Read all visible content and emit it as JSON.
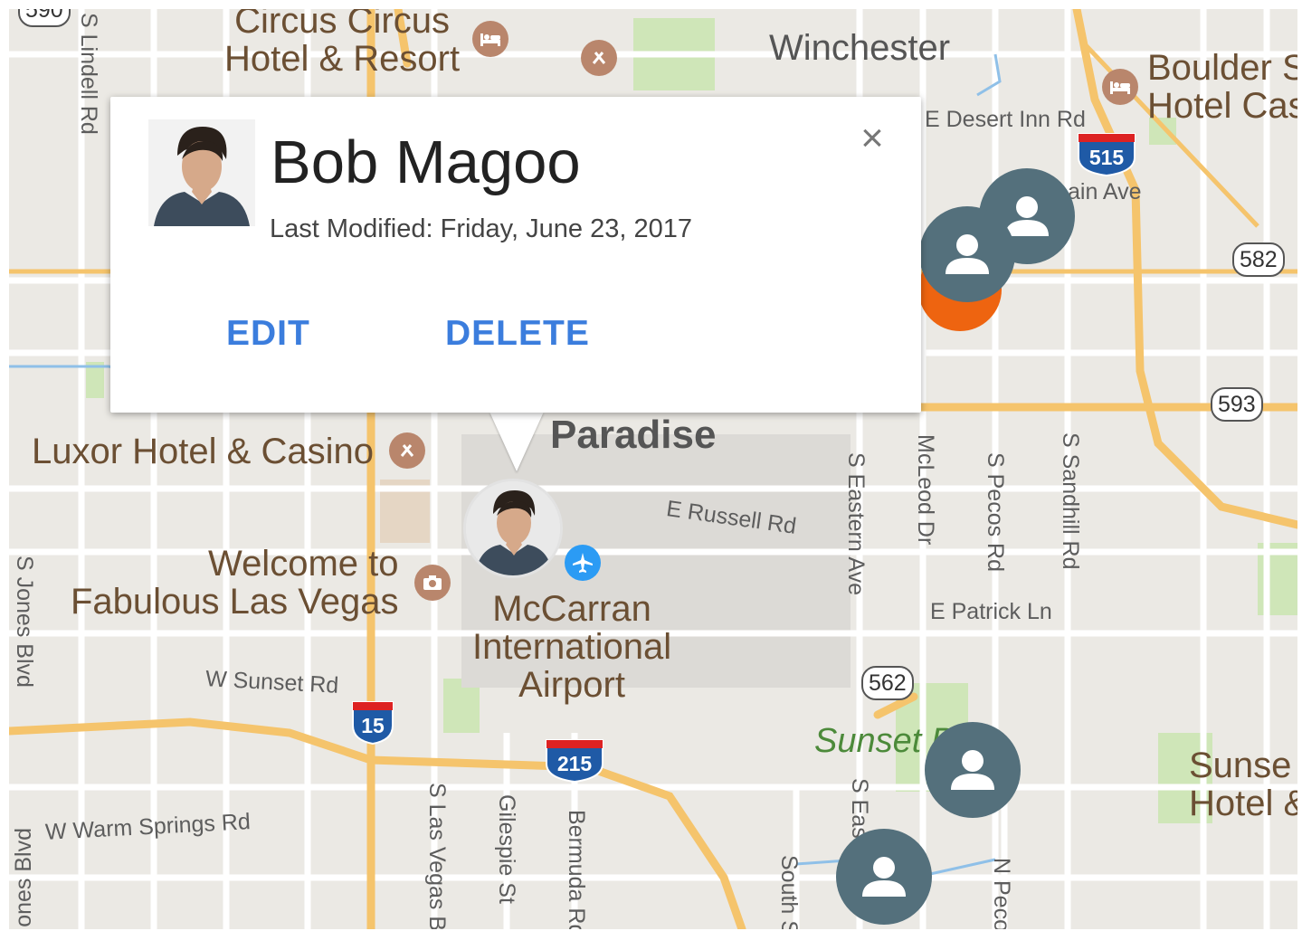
{
  "popup": {
    "name": "Bob Magoo",
    "last_modified": "Last Modified: Friday, June 23, 2017",
    "edit_label": "EDIT",
    "delete_label": "DELETE",
    "close_glyph": "×"
  },
  "map": {
    "places": {
      "circus_circus": "Circus Circus\nHotel & Resort",
      "winchester": "Winchester",
      "boulder": "Boulder S\nHotel Cas",
      "luxor": "Luxor Hotel & Casino",
      "paradise": "Paradise",
      "welcome": "Welcome to\nFabulous Las Vegas",
      "mccarran": "McCarran\nInternational\nAirport",
      "sunset_park": "Sunset P",
      "sunset_hotel": "Sunse\nHotel &"
    },
    "roads": {
      "lindell": "S Lindell Rd",
      "desert_inn": "E Desert Inn Rd",
      "main_ave": "ain Ave",
      "russell": "E Russell Rd",
      "eastern": "S Eastern Ave",
      "mcleod": "McLeod Dr",
      "pecos": "S Pecos Rd",
      "sandhill": "S Sandhill Rd",
      "patrick": "E Patrick Ln",
      "sunset": "W Sunset Rd",
      "jones": "S Jones Blvd",
      "jones2": "ones Blvd",
      "warm_springs": "W Warm Springs Rd",
      "las_vegas_blvd": "S Las Vegas B",
      "gilespie": "Gilespie St",
      "bermuda": "Bermuda Rd",
      "south": "South S",
      "n_pecos": "N Peco",
      "s_eastern2": "S Eas"
    },
    "shields": {
      "i15": "15",
      "i215": "215",
      "i515": "515",
      "s582": "582",
      "s593": "593",
      "s562": "562",
      "top_left": "590"
    },
    "colors": {
      "marker": "#54707c",
      "highway": "#f5c46c",
      "accent": "#3b7ddd",
      "orange": "#ee6410"
    },
    "icons": [
      "hotel-icon",
      "food-icon",
      "airport-icon",
      "camera-icon",
      "person-icon"
    ]
  }
}
